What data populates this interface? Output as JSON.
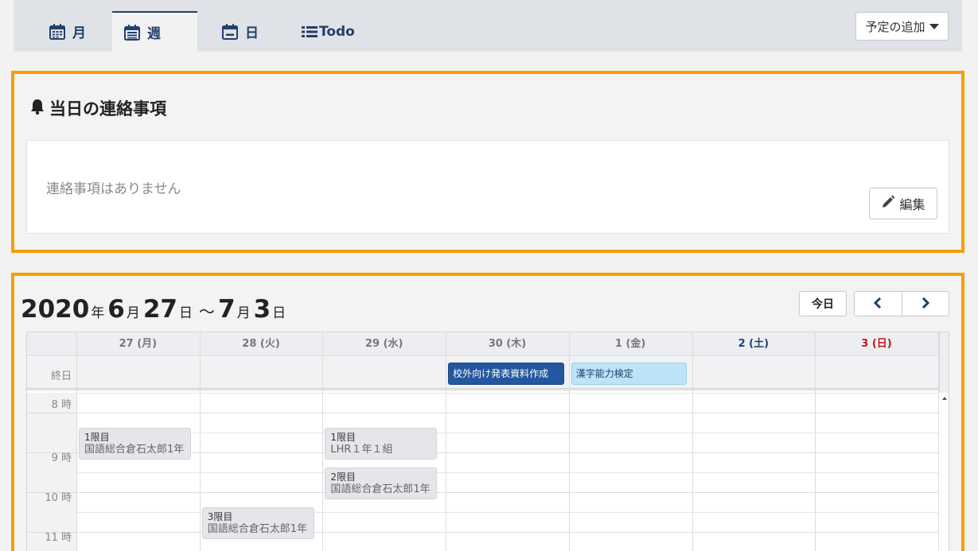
{
  "tabs": [
    {
      "label": "月",
      "icon": "calendar-month-icon"
    },
    {
      "label": "週",
      "icon": "calendar-week-icon",
      "active": true
    },
    {
      "label": "日",
      "icon": "calendar-day-icon"
    },
    {
      "label": "Todo",
      "icon": "list-icon"
    }
  ],
  "add_button": {
    "label": "予定の追加"
  },
  "notices": {
    "title": "当日の連絡事項",
    "empty_text": "連絡事項はありません",
    "edit_label": "編集"
  },
  "calendar": {
    "range": {
      "start_year": "2020",
      "year_unit": "年",
      "start_month": "6",
      "month_unit": "月",
      "start_day": "27",
      "day_unit": "日",
      "separator": "～",
      "end_month": "7",
      "end_day": "3"
    },
    "today_label": "今日",
    "days": [
      {
        "label": "27 (月)",
        "type": "weekday"
      },
      {
        "label": "28 (火)",
        "type": "weekday"
      },
      {
        "label": "29 (水)",
        "type": "weekday"
      },
      {
        "label": "30 (木)",
        "type": "weekday"
      },
      {
        "label": "1 (金)",
        "type": "weekday"
      },
      {
        "label": "2 (土)",
        "type": "sat"
      },
      {
        "label": "3 (日)",
        "type": "sun"
      }
    ],
    "allday_label": "終日",
    "allday_events": [
      {
        "day": 3,
        "title": "校外向け発表資料作成",
        "style": "dark"
      },
      {
        "day": 4,
        "title": "漢字能力検定",
        "style": "light"
      }
    ],
    "hours": [
      "8 時",
      "9 時",
      "10 時",
      "11 時"
    ],
    "timed_events": [
      {
        "day": 0,
        "period": "1限目",
        "title": "国語総合倉石太郎1年",
        "start": 9.0
      },
      {
        "day": 2,
        "period": "1限目",
        "title": "LHR１年１組",
        "start": 9.0
      },
      {
        "day": 2,
        "period": "2限目",
        "title": "国語総合倉石太郎1年",
        "start": 10.0
      },
      {
        "day": 1,
        "period": "3限目",
        "title": "国語総合倉石太郎1年",
        "start": 11.0
      }
    ]
  }
}
